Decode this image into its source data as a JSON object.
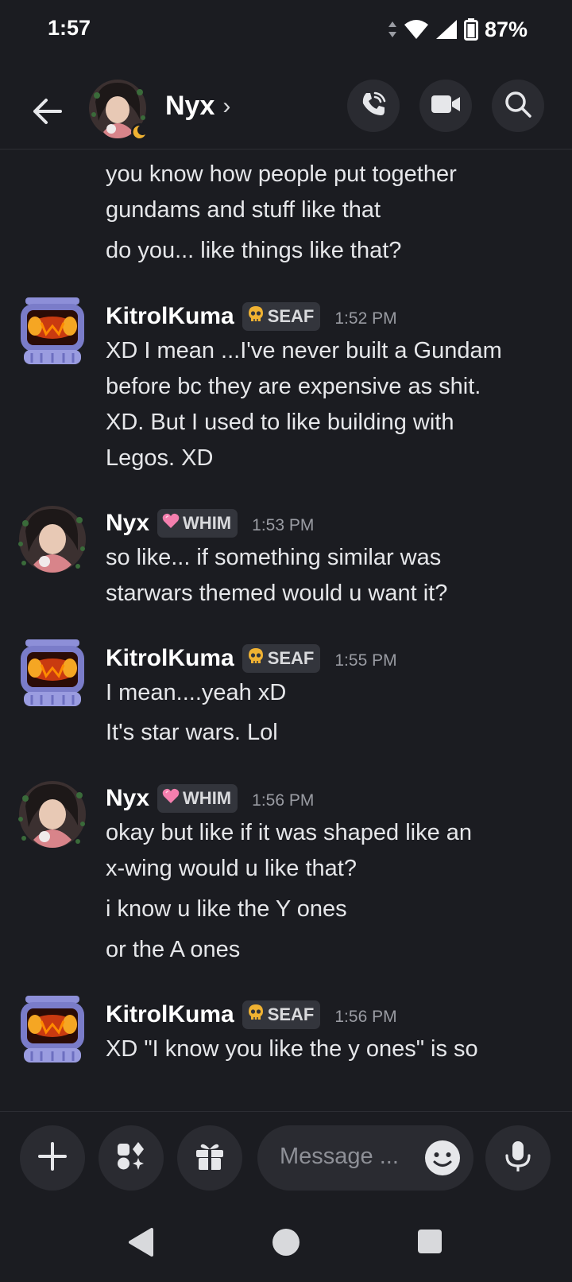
{
  "status_bar": {
    "time": "1:57",
    "battery": "87%"
  },
  "header": {
    "contact_name": "Nyx",
    "chevron": "›"
  },
  "thread": [
    {
      "type": "continuation",
      "lines": [
        "you know how people put together",
        "gundams and stuff like that"
      ]
    },
    {
      "type": "continuation",
      "lines": [
        "do you... like things like that?"
      ]
    },
    {
      "type": "message",
      "author": "KitrolKuma",
      "tag": "SEAF",
      "time": "1:52 PM",
      "lines": [
        "XD I mean ...I've never built a Gundam",
        "before bc they are expensive as shit.",
        "XD. But I used to like building with",
        "Legos. XD"
      ]
    },
    {
      "type": "message",
      "author": "Nyx",
      "tag": "WHIM",
      "time": "1:53 PM",
      "lines": [
        "so like... if something similar was",
        "starwars themed would u want it?"
      ]
    },
    {
      "type": "message",
      "author": "KitrolKuma",
      "tag": "SEAF",
      "time": "1:55 PM",
      "lines": [
        "I mean....yeah xD"
      ]
    },
    {
      "type": "continuation",
      "lines": [
        "It's star wars. Lol"
      ]
    },
    {
      "type": "message",
      "author": "Nyx",
      "tag": "WHIM",
      "time": "1:56 PM",
      "lines": [
        "okay but like if it was shaped like an",
        "x-wing would u like that?"
      ]
    },
    {
      "type": "continuation",
      "lines": [
        "i know u like the Y ones"
      ]
    },
    {
      "type": "continuation",
      "lines": [
        "or the A ones"
      ]
    },
    {
      "type": "message",
      "author": "KitrolKuma",
      "tag": "SEAF",
      "time": "1:56 PM",
      "lines": [
        "XD \"I know you like the y ones\" is so"
      ]
    }
  ],
  "composer": {
    "placeholder": "Message ..."
  },
  "icons": {
    "back": "arrow-left-icon",
    "call": "phone-call-icon",
    "video": "video-camera-icon",
    "search": "search-icon",
    "plus": "plus-icon",
    "apps": "apps-icon",
    "gift": "gift-icon",
    "emoji": "emoji-icon",
    "mic": "microphone-icon"
  },
  "colors": {
    "background": "#1b1c21",
    "button_bg": "#2a2b31",
    "tag_bg": "#33353c",
    "muted_text": "#9a9ca3"
  }
}
